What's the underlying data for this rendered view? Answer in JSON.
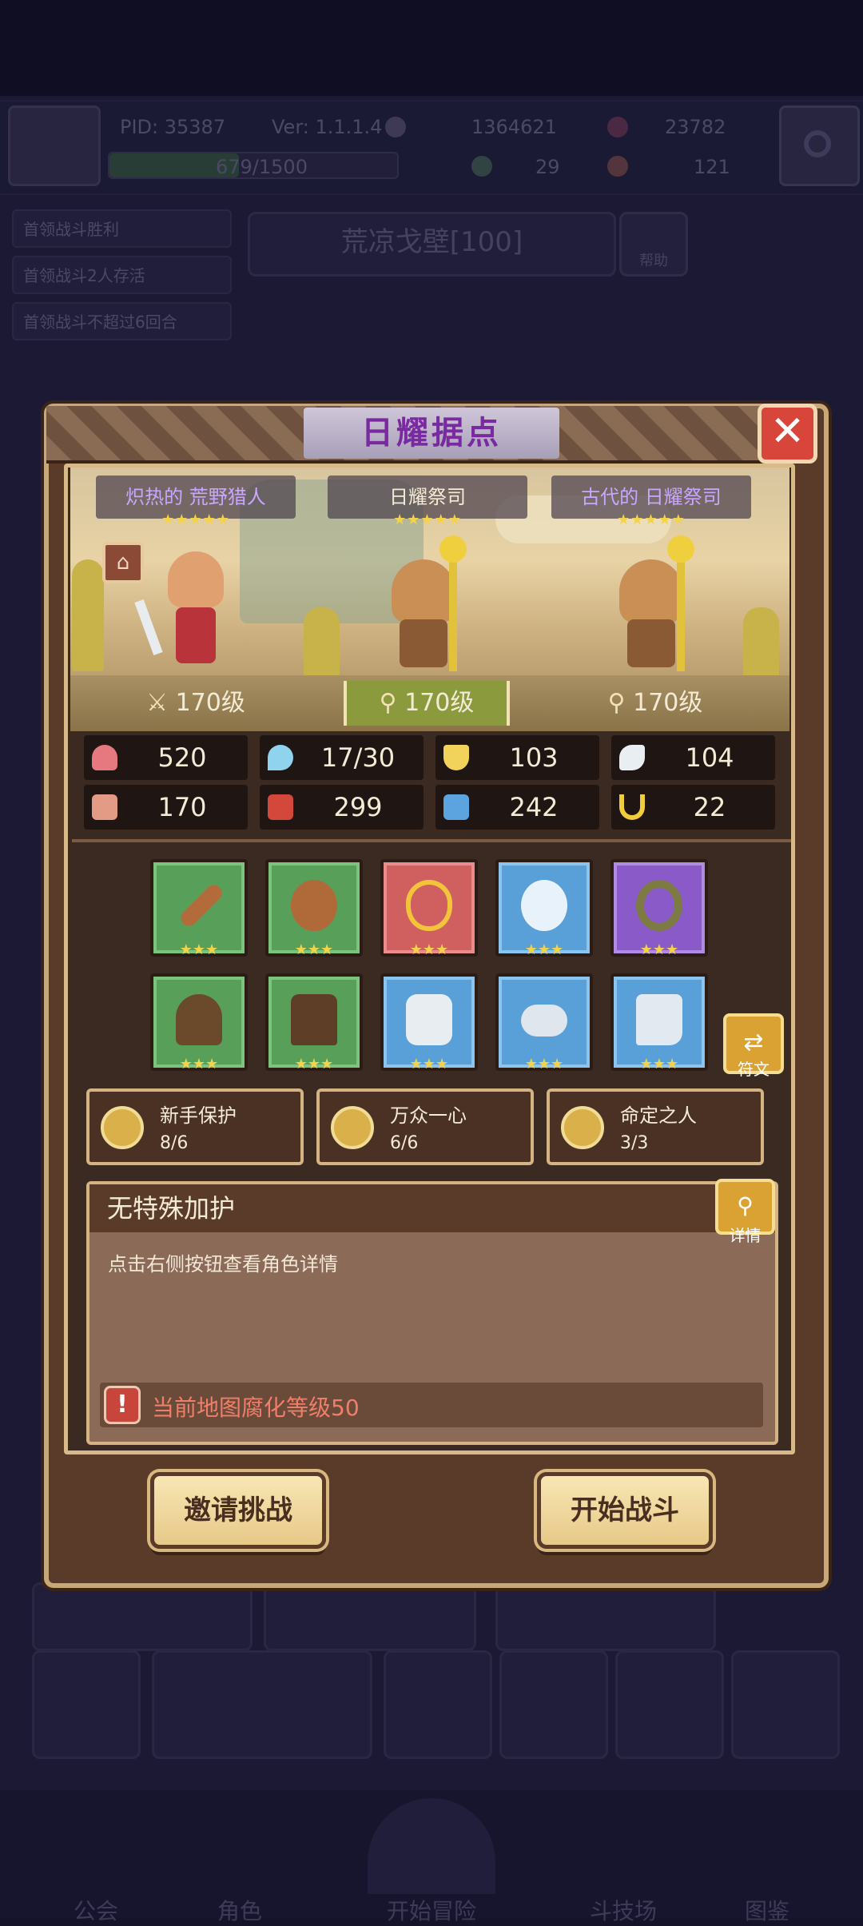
{
  "hud": {
    "pid": "PID: 35387",
    "version": "Ver: 1.1.1.4",
    "gold": "1364621",
    "gems": "23782",
    "exp": "679/1500",
    "clovers": "29",
    "keys": "121"
  },
  "tasks": [
    "首领战斗胜利",
    "首领战斗2人存活",
    "首领战斗不超过6回合"
  ],
  "map_title": "荒凉戈壁[100]",
  "help_label": "帮助",
  "dialog": {
    "title": "日耀据点",
    "close_icon": "close-icon",
    "characters": [
      {
        "name": "炽热的 荒野猎人",
        "stars": "★★★★★",
        "level": "170级"
      },
      {
        "name": "日耀祭司",
        "stars": "★★★★★",
        "level": "170级"
      },
      {
        "name": "古代的 日耀祭司",
        "stars": "★★★★★",
        "level": "170级"
      }
    ],
    "stats": [
      {
        "icon": "heart-icon",
        "value": "520",
        "color": "#e5797f"
      },
      {
        "icon": "mana-drop-icon",
        "value": "17/30",
        "color": "#8fd3ef"
      },
      {
        "icon": "shield-icon",
        "value": "103",
        "color": "#f1d25a"
      },
      {
        "icon": "wing-icon",
        "value": "104",
        "color": "#e8eef2"
      },
      {
        "icon": "fist-icon",
        "value": "170",
        "color": "#e49b86"
      },
      {
        "icon": "book-icon",
        "value": "299",
        "color": "#d4483c"
      },
      {
        "icon": "boot-icon",
        "value": "242",
        "color": "#5ca4e0"
      },
      {
        "icon": "horseshoe-icon",
        "value": "22",
        "color": "#f1cc3b"
      }
    ],
    "equipment": [
      {
        "icon": "club-icon",
        "rarity": "green",
        "stars": "★★★"
      },
      {
        "icon": "wooden-shield-icon",
        "rarity": "green",
        "stars": "★★★"
      },
      {
        "icon": "gold-necklace-icon",
        "rarity": "red",
        "stars": "★★★"
      },
      {
        "icon": "crystal-orb-icon",
        "rarity": "blue",
        "stars": "★★★"
      },
      {
        "icon": "gem-ring-icon",
        "rarity": "purple",
        "stars": "★★★"
      },
      {
        "icon": "leather-hat-icon",
        "rarity": "green",
        "stars": "★★★"
      },
      {
        "icon": "leather-armor-icon",
        "rarity": "green",
        "stars": "★★★"
      },
      {
        "icon": "silver-gauntlet-icon",
        "rarity": "blue",
        "stars": "★★★"
      },
      {
        "icon": "silver-belt-icon",
        "rarity": "blue",
        "stars": "★★★"
      },
      {
        "icon": "silver-boots-icon",
        "rarity": "blue",
        "stars": "★★★"
      }
    ],
    "rune_label": "符文",
    "buffs": [
      {
        "name": "新手保护",
        "value": "8/6"
      },
      {
        "name": "万众一心",
        "value": "6/6"
      },
      {
        "name": "命定之人",
        "value": "3/3"
      }
    ],
    "blessing_title": "无特殊加护",
    "detail_label": "详情",
    "hint": "点击右侧按钮查看角色详情",
    "warning": "当前地图腐化等级50",
    "invite_button": "邀请挑战",
    "start_button": "开始战斗"
  },
  "bottom_nav": [
    "公会",
    "角色",
    "开始冒险",
    "斗技场",
    "图鉴"
  ]
}
